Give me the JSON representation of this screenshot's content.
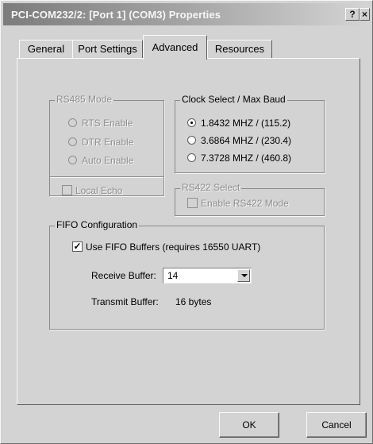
{
  "window": {
    "title": "PCI-COM232/2: [Port 1] (COM3) Properties",
    "help_label": "?",
    "close_label": "×"
  },
  "tabs": [
    {
      "label": "General"
    },
    {
      "label": "Port Settings"
    },
    {
      "label": "Advanced"
    },
    {
      "label": "Resources"
    }
  ],
  "rs485": {
    "title": "RS485 Mode",
    "options": [
      {
        "label": "RTS Enable"
      },
      {
        "label": "DTR Enable"
      },
      {
        "label": "Auto Enable"
      }
    ],
    "local_echo_label": "Local Echo"
  },
  "clock": {
    "title": "Clock Select / Max Baud",
    "options": [
      {
        "label": "1.8432 MHZ / (115.2)",
        "selected": true
      },
      {
        "label": "3.6864 MHZ / (230.4)",
        "selected": false
      },
      {
        "label": "7.3728 MHZ / (460.8)",
        "selected": false
      }
    ]
  },
  "rs422": {
    "title": "RS422 Select",
    "enable_label": "Enable RS422 Mode"
  },
  "fifo": {
    "title": "FIFO Configuration",
    "use_label": "Use FIFO Buffers (requires 16550 UART)",
    "receive_label": "Receive Buffer:",
    "receive_value": "14",
    "transmit_label": "Transmit Buffer:",
    "transmit_value": "16 bytes"
  },
  "buttons": {
    "ok": "OK",
    "cancel": "Cancel"
  }
}
